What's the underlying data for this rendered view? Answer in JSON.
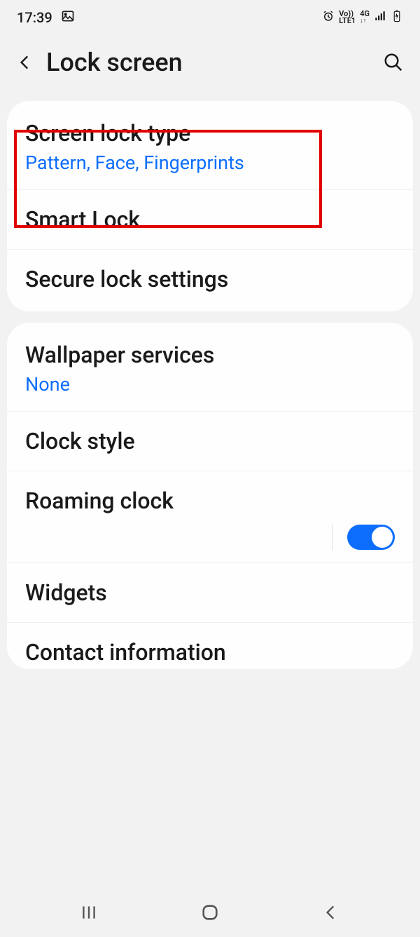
{
  "status": {
    "time": "17:39",
    "volte": "Vo))",
    "lte": "LTE1",
    "gen": "4G"
  },
  "header": {
    "title": "Lock screen"
  },
  "card1": {
    "screen_lock": {
      "title": "Screen lock type",
      "subtitle": "Pattern, Face, Fingerprints"
    },
    "smart_lock": {
      "title": "Smart Lock"
    },
    "secure_lock": {
      "title": "Secure lock settings"
    }
  },
  "card2": {
    "wallpaper": {
      "title": "Wallpaper services",
      "subtitle": "None"
    },
    "clock_style": {
      "title": "Clock style"
    },
    "roaming": {
      "title": "Roaming clock"
    },
    "widgets": {
      "title": "Widgets"
    },
    "contact": {
      "title": "Contact information"
    }
  }
}
